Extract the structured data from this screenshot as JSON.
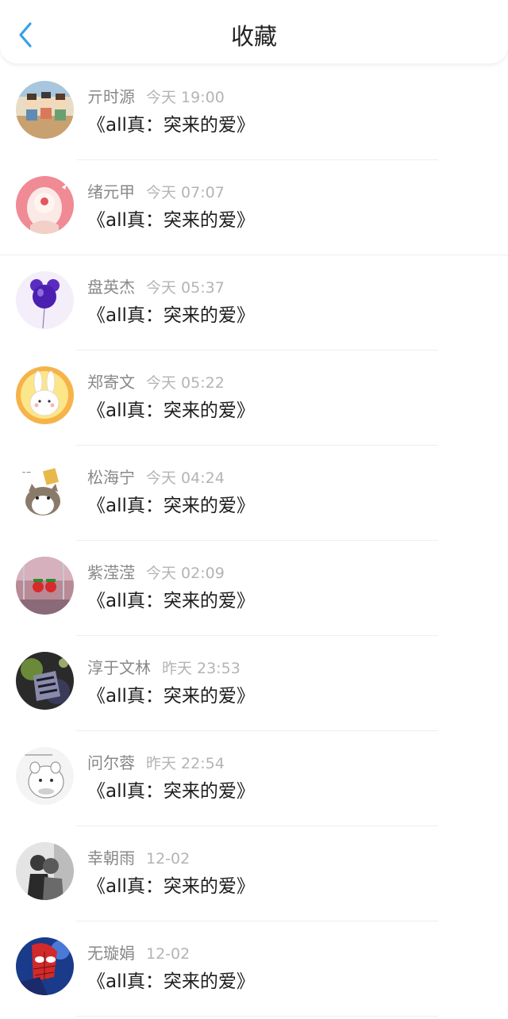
{
  "header": {
    "title": "收藏",
    "back_icon": "chevron-left-icon",
    "accent_color": "#3aa0e8"
  },
  "favorites": [
    {
      "name": "亓时源",
      "time": "今天 19:00",
      "title": "《all真：突来的爱》",
      "avatar": "cartoon-group-avatar"
    },
    {
      "name": "绪元甲",
      "time": "今天 07:07",
      "title": "《all真：突来的爱》",
      "avatar": "pink-anime-girl-avatar"
    },
    {
      "name": "盘英杰",
      "time": "今天 05:37",
      "title": "《all真：突来的爱》",
      "avatar": "purple-balloon-avatar"
    },
    {
      "name": "郑寄文",
      "time": "今天 05:22",
      "title": "《all真：突来的爱》",
      "avatar": "white-rabbit-avatar"
    },
    {
      "name": "松海宁",
      "time": "今天 04:24",
      "title": "《all真：突来的爱》",
      "avatar": "cartoon-cat-avatar"
    },
    {
      "name": "紫滢滢",
      "time": "今天 02:09",
      "title": "《all真：突来的爱》",
      "avatar": "strawberry-photo-avatar"
    },
    {
      "name": "淳于文林",
      "time": "昨天 23:53",
      "title": "《all真：突来的爱》",
      "avatar": "dark-anime-avatar"
    },
    {
      "name": "问尔蓉",
      "time": "昨天 22:54",
      "title": "《all真：突来的爱》",
      "avatar": "hamster-sketch-avatar"
    },
    {
      "name": "幸朝雨",
      "time": "12-02",
      "title": "《all真：突来的爱》",
      "avatar": "bw-couple-avatar"
    },
    {
      "name": "无璇娟",
      "time": "12-02",
      "title": "《all真：突来的爱》",
      "avatar": "spiderman-avatar"
    }
  ]
}
